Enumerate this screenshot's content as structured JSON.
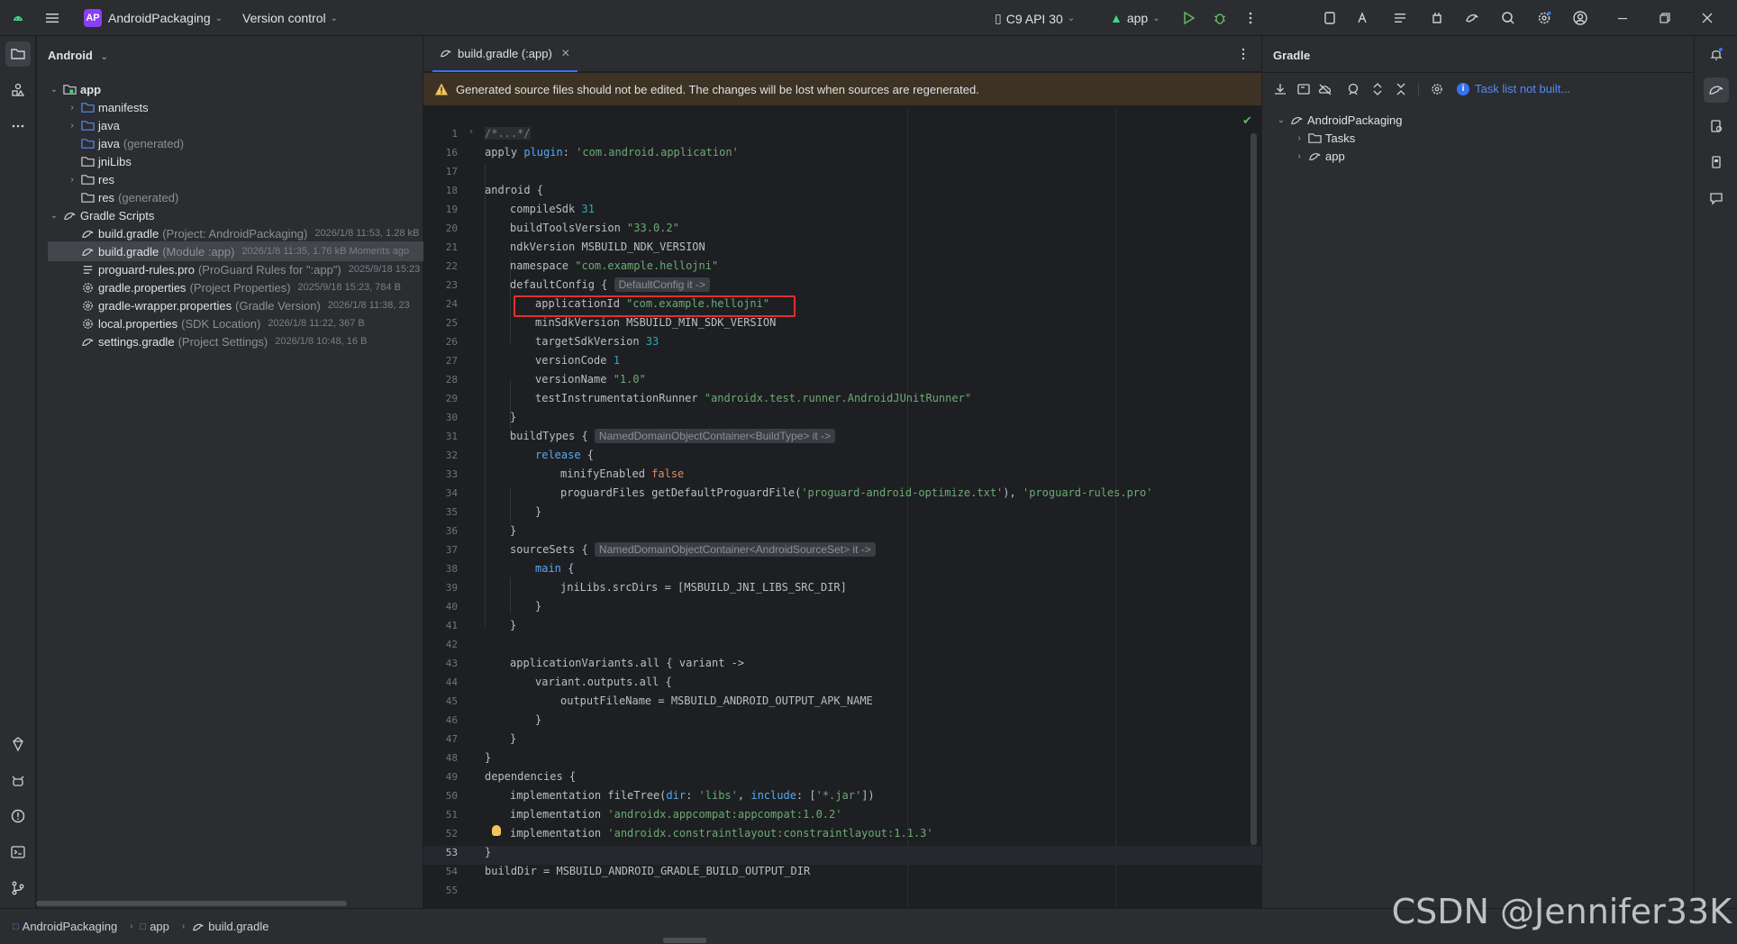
{
  "titlebar": {
    "project_badge": "AP",
    "project_name": "AndroidPackaging",
    "vcs": "Version control",
    "device": "C9 API 30",
    "run_config": "app"
  },
  "project_panel": {
    "title": "Android",
    "items": [
      {
        "label": "app",
        "gray": "",
        "meta": ""
      },
      {
        "label": "manifests",
        "gray": "",
        "meta": ""
      },
      {
        "label": "java",
        "gray": "",
        "meta": ""
      },
      {
        "label": "java",
        "gray": "(generated)",
        "meta": ""
      },
      {
        "label": "jniLibs",
        "gray": "",
        "meta": ""
      },
      {
        "label": "res",
        "gray": "",
        "meta": ""
      },
      {
        "label": "res",
        "gray": "(generated)",
        "meta": ""
      },
      {
        "label": "Gradle Scripts",
        "gray": "",
        "meta": ""
      },
      {
        "label": "build.gradle",
        "gray": "(Project: AndroidPackaging)",
        "meta": "2026/1/8 11:53, 1.28 kB"
      },
      {
        "label": "build.gradle",
        "gray": "(Module :app)",
        "meta": "2026/1/8 11:35, 1.76 kB Moments ago"
      },
      {
        "label": "proguard-rules.pro",
        "gray": "(ProGuard Rules for \":app\")",
        "meta": "2025/9/18 15:23"
      },
      {
        "label": "gradle.properties",
        "gray": "(Project Properties)",
        "meta": "2025/9/18 15:23, 784 B"
      },
      {
        "label": "gradle-wrapper.properties",
        "gray": "(Gradle Version)",
        "meta": "2026/1/8 11:38, 23"
      },
      {
        "label": "local.properties",
        "gray": "(SDK Location)",
        "meta": "2026/1/8 11:22, 367 B"
      },
      {
        "label": "settings.gradle",
        "gray": "(Project Settings)",
        "meta": "2026/1/8 10:48, 16 B"
      }
    ]
  },
  "editor": {
    "tab_label": "build.gradle (:app)",
    "banner": "Generated source files should not be edited. The changes will be lost when sources are regenerated.",
    "line_numbers": [
      "1",
      "16",
      "17",
      "18",
      "19",
      "20",
      "21",
      "22",
      "23",
      "24",
      "25",
      "26",
      "27",
      "28",
      "29",
      "30",
      "31",
      "32",
      "33",
      "34",
      "35",
      "36",
      "37",
      "38",
      "39",
      "40",
      "41",
      "42",
      "43",
      "44",
      "45",
      "46",
      "47",
      "48",
      "49",
      "50",
      "51",
      "52",
      "53",
      "54",
      "55"
    ]
  },
  "gradle_panel": {
    "title": "Gradle",
    "task_list": "Task list not built...",
    "tree": [
      "AndroidPackaging",
      "Tasks",
      "app"
    ]
  },
  "breadcrumb": [
    "AndroidPackaging",
    "app",
    "build.gradle"
  ],
  "watermark": "CSDN @Jennifer33K",
  "colors": {
    "accent": "#3574f0",
    "highlight_box": "#e0312f",
    "banner_bg": "#3d3223"
  }
}
